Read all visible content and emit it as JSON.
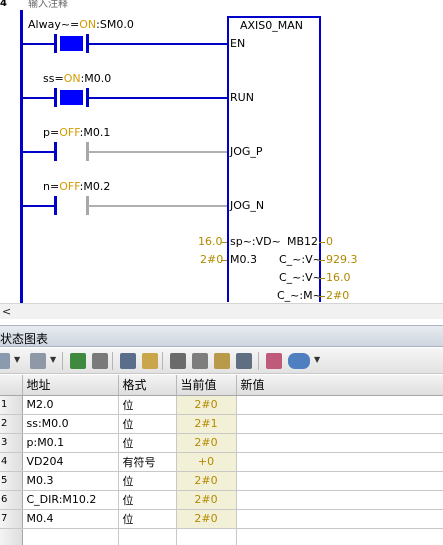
{
  "ladder": {
    "network_number": "4",
    "network_comment": "输入注释",
    "contacts": [
      {
        "label": "Alway~=",
        "state": "ON",
        "address": ":SM0.0",
        "energized": true
      },
      {
        "label": "ss=",
        "state": "ON",
        "address": ":M0.0",
        "energized": true
      },
      {
        "label": "p=",
        "state": "OFF",
        "address": ":M0.1",
        "energized": false
      },
      {
        "label": "n=",
        "state": "OFF",
        "address": ":M0.2",
        "energized": false
      }
    ],
    "block": {
      "title": "AXIS0_MAN",
      "inputs": [
        "EN",
        "RUN",
        "JOG_P",
        "JOG_N",
        "sp~:VD~",
        "M0.3"
      ],
      "outputs": [
        "MB12",
        "C_~:V~",
        "C_~:V~",
        "C_~:M~"
      ],
      "input_values": {
        "sp": "16.0",
        "m03": "2#0"
      },
      "output_values": {
        "mb12": "0",
        "cv1": "929.3",
        "cv2": "16.0",
        "cm": "2#0"
      }
    }
  },
  "scrollbar": {
    "left_arrow": "<"
  },
  "status_chart": {
    "title": "状态图表",
    "columns": [
      "",
      "地址",
      "格式",
      "当前值",
      "新值"
    ],
    "rows": [
      {
        "num": "1",
        "address": "M2.0",
        "format": "位",
        "value": "2#0",
        "new": ""
      },
      {
        "num": "2",
        "address": "ss:M0.0",
        "format": "位",
        "value": "2#1",
        "new": ""
      },
      {
        "num": "3",
        "address": "p:M0.1",
        "format": "位",
        "value": "2#0",
        "new": ""
      },
      {
        "num": "4",
        "address": "VD204",
        "format": "有符号",
        "value": "+0",
        "new": ""
      },
      {
        "num": "5",
        "address": "M0.3",
        "format": "位",
        "value": "2#0",
        "new": ""
      },
      {
        "num": "6",
        "address": "C_DIR:M10.2",
        "format": "位",
        "value": "2#0",
        "new": ""
      },
      {
        "num": "7",
        "address": "M0.4",
        "format": "位",
        "value": "2#0",
        "new": ""
      }
    ]
  },
  "colors": {
    "wire": "#0000c8",
    "contact_on": "#0000ff",
    "status_value": "#d69a00"
  }
}
